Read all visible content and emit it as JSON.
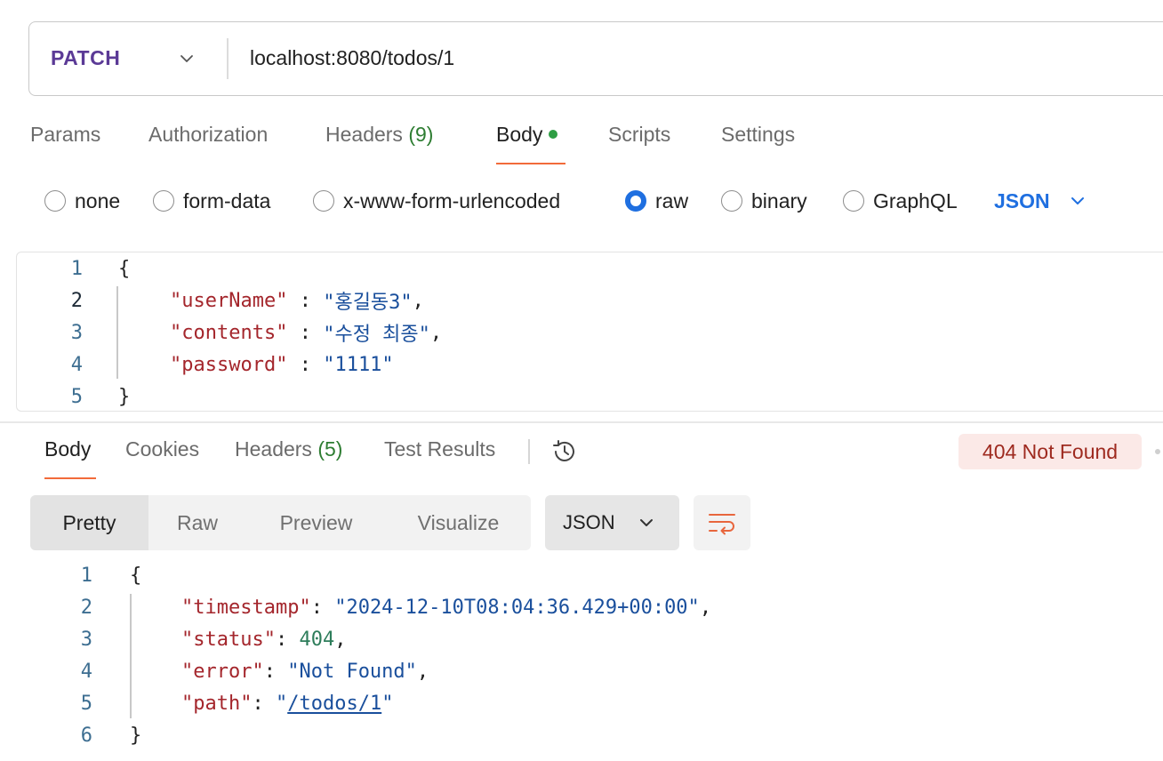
{
  "request": {
    "method": "PATCH",
    "url": "localhost:8080/todos/1"
  },
  "request_tabs": [
    {
      "label": "Params",
      "count": ""
    },
    {
      "label": "Authorization",
      "count": ""
    },
    {
      "label": "Headers",
      "count": "(9)"
    },
    {
      "label": "Body",
      "count": ""
    },
    {
      "label": "Scripts",
      "count": ""
    },
    {
      "label": "Settings",
      "count": ""
    }
  ],
  "active_request_tab": "Body",
  "body_types": {
    "none": "none",
    "form_data": "form-data",
    "urlencoded": "x-www-form-urlencoded",
    "raw": "raw",
    "binary": "binary",
    "graphql": "GraphQL",
    "selected": "raw",
    "language": "JSON"
  },
  "request_body": {
    "line_numbers": [
      "1",
      "2",
      "3",
      "4",
      "5"
    ],
    "open_brace": "{",
    "close_brace": "}",
    "lines": [
      {
        "key": "\"userName\"",
        "sep": " : ",
        "value": "\"홍길동3\"",
        "trail": ","
      },
      {
        "key": "\"contents\"",
        "sep": " : ",
        "value": "\"수정 최종\"",
        "trail": ","
      },
      {
        "key": "\"password\"",
        "sep": " : ",
        "value": "\"1111\"",
        "trail": ""
      }
    ]
  },
  "response_tabs": {
    "body": "Body",
    "cookies": "Cookies",
    "headers": "Headers",
    "headers_count": "(5)",
    "test_results": "Test Results"
  },
  "status": {
    "text": "404 Not Found",
    "color": "#9e2a1f",
    "background": "#fbe9e7"
  },
  "view_modes": {
    "pretty": "Pretty",
    "raw": "Raw",
    "preview": "Preview",
    "visualize": "Visualize",
    "selected": "Pretty"
  },
  "response_format": "JSON",
  "response_body": {
    "line_numbers": [
      "1",
      "2",
      "3",
      "4",
      "5",
      "6"
    ],
    "open_brace": "{",
    "close_brace": "}",
    "timestamp_key": "\"timestamp\"",
    "timestamp_value": "\"2024-12-10T08:04:36.429+00:00\"",
    "status_key": "\"status\"",
    "status_value": "404",
    "error_key": "\"error\"",
    "error_value": "\"Not Found\"",
    "path_key": "\"path\"",
    "path_quote": "\"",
    "path_value": "/todos/1"
  },
  "icons": {
    "method_dropdown": "chevron-down-icon",
    "language_dropdown": "chevron-down-icon",
    "history": "history-icon",
    "wrap": "wrap-lines-icon"
  },
  "colors": {
    "method": "#5b3a96",
    "accent_tab": "#f26b3a",
    "radio_selected": "#1f6fe0",
    "json_key": "#a4262c",
    "json_string": "#1a4f9c",
    "json_number": "#2e7d5b",
    "count": "#2e7d32"
  }
}
